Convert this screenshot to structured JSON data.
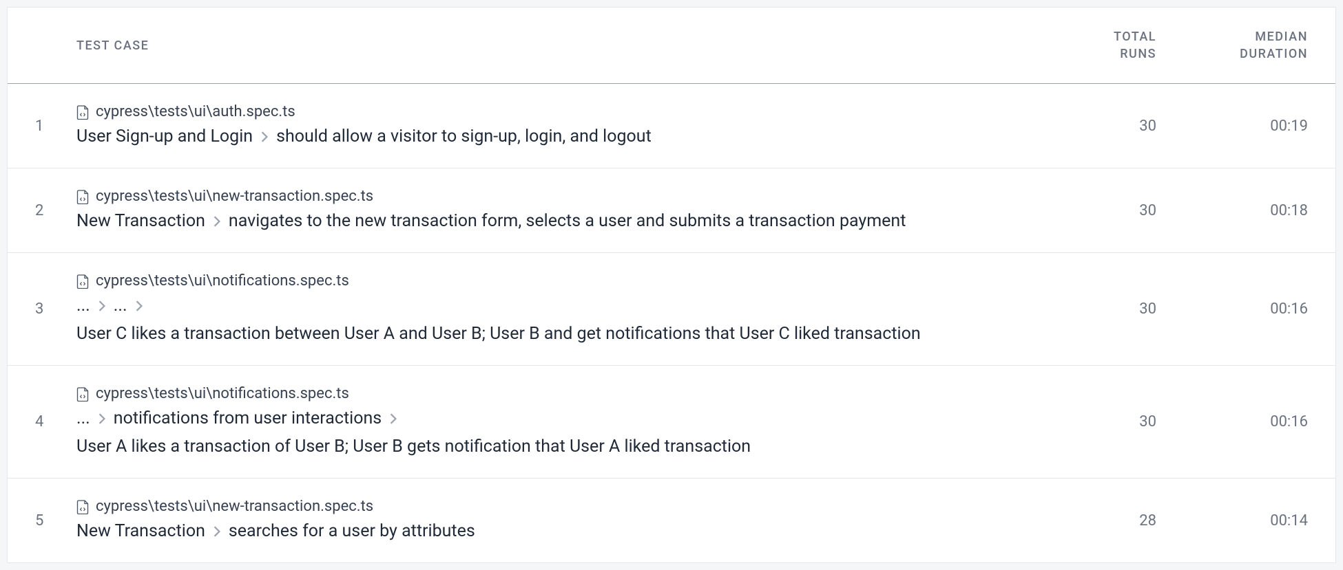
{
  "columns": {
    "test_case": "TEST CASE",
    "total_runs": "TOTAL\nRUNS",
    "median_duration": "MEDIAN\nDURATION"
  },
  "rows": [
    {
      "index": "1",
      "file": "cypress\\tests\\ui\\auth.spec.ts",
      "breadcrumb": [
        "User Sign-up and Login",
        "should allow a visitor to sign-up, login, and logout"
      ],
      "description": "",
      "runs": "30",
      "duration": "00:19"
    },
    {
      "index": "2",
      "file": "cypress\\tests\\ui\\new-transaction.spec.ts",
      "breadcrumb": [
        "New Transaction",
        "navigates to the new transaction form, selects a user and submits a transaction payment"
      ],
      "description": "",
      "runs": "30",
      "duration": "00:18"
    },
    {
      "index": "3",
      "file": "cypress\\tests\\ui\\notifications.spec.ts",
      "breadcrumb": [
        "...",
        "...",
        ""
      ],
      "description": "User C likes a transaction between User A and User B; User B and get notifications that User C liked transaction",
      "runs": "30",
      "duration": "00:16"
    },
    {
      "index": "4",
      "file": "cypress\\tests\\ui\\notifications.spec.ts",
      "breadcrumb": [
        "...",
        "notifications from user interactions",
        ""
      ],
      "description": "User A likes a transaction of User B; User B gets notification that User A liked transaction",
      "runs": "30",
      "duration": "00:16"
    },
    {
      "index": "5",
      "file": "cypress\\tests\\ui\\new-transaction.spec.ts",
      "breadcrumb": [
        "New Transaction",
        "searches for a user by attributes"
      ],
      "description": "",
      "runs": "28",
      "duration": "00:14"
    }
  ]
}
